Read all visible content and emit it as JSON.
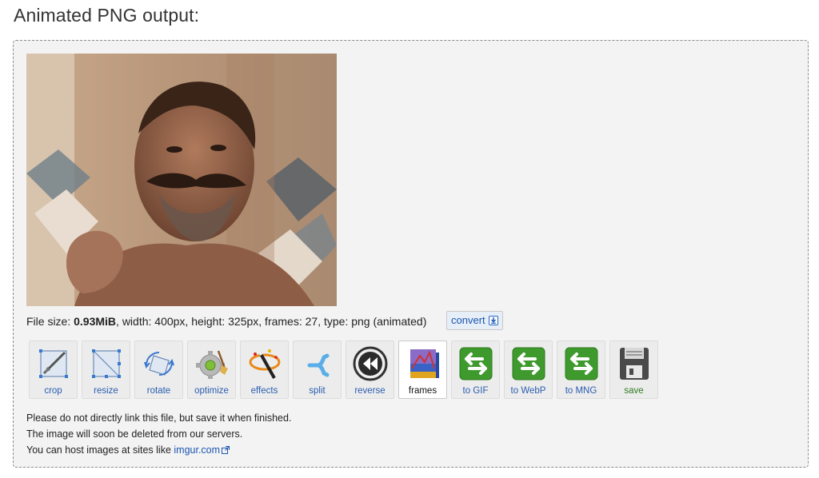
{
  "page": {
    "title": "Animated PNG output:"
  },
  "file_info": {
    "size_label": "File size: ",
    "size_value": "0.93MiB",
    "rest": ", width: 400px, height: 325px, frames: 27, type: png (animated)"
  },
  "convert": {
    "label": "convert"
  },
  "tools": [
    {
      "label": "crop",
      "icon": "crop-icon"
    },
    {
      "label": "resize",
      "icon": "resize-icon"
    },
    {
      "label": "rotate",
      "icon": "rotate-icon"
    },
    {
      "label": "optimize",
      "icon": "optimize-icon"
    },
    {
      "label": "effects",
      "icon": "effects-icon"
    },
    {
      "label": "split",
      "icon": "split-icon"
    },
    {
      "label": "reverse",
      "icon": "reverse-icon"
    },
    {
      "label": "frames",
      "icon": "frames-icon",
      "active": true
    },
    {
      "label": "to GIF",
      "icon": "convert-arrows-icon"
    },
    {
      "label": "to WebP",
      "icon": "convert-arrows-icon"
    },
    {
      "label": "to MNG",
      "icon": "convert-arrows-icon"
    },
    {
      "label": "save",
      "icon": "floppy-disk-icon"
    }
  ],
  "notes": {
    "line1": "Please do not directly link this file, but save it when finished.",
    "line2": "The image will soon be deleted from our servers.",
    "line3_prefix": "You can host images at sites like ",
    "link_text": "imgur.com"
  },
  "colors": {
    "link": "#1a55b0",
    "panel_bg": "#f3f3f3",
    "save_green": "#2f7a1e"
  }
}
